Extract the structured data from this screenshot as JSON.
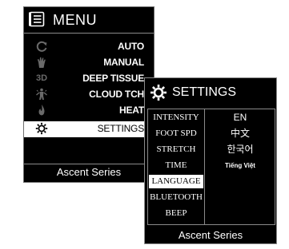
{
  "menu": {
    "title": "MENU",
    "header_icon": "list-icon",
    "items": [
      {
        "label": "AUTO",
        "icon": "cycle-icon"
      },
      {
        "label": "MANUAL",
        "icon": "hand-icon"
      },
      {
        "label": "DEEP TISSUE",
        "icon": "3d-icon",
        "icon_text": "3D"
      },
      {
        "label": "CLOUD TCH",
        "icon": "body-massage-icon"
      },
      {
        "label": "HEAT",
        "icon": "flame-icon"
      },
      {
        "label": "SETTINGS",
        "icon": "gear-icon"
      }
    ],
    "selected": "SETTINGS",
    "footer": "Ascent Series"
  },
  "settings": {
    "title": "SETTINGS",
    "header_icon": "gear-icon",
    "options": [
      {
        "label": "INTENSITY"
      },
      {
        "label": "FOOT SPD"
      },
      {
        "label": "STRETCH"
      },
      {
        "label": "TIME"
      },
      {
        "label": "LANGUAGE"
      },
      {
        "label": "BLUETOOTH"
      },
      {
        "label": "BEEP"
      }
    ],
    "selected": "LANGUAGE",
    "languages": [
      {
        "label": "EN"
      },
      {
        "label": "中文"
      },
      {
        "label": "한국어"
      },
      {
        "label": "Tiếng Việt"
      }
    ],
    "footer": "Ascent Series"
  },
  "colors": {
    "screen_bg": "#000000",
    "text": "#ffffff",
    "selected_bg": "#ffffff",
    "selected_text": "#000000",
    "dim_icon": "#6a6a6a",
    "border": "#8a8a8a"
  }
}
